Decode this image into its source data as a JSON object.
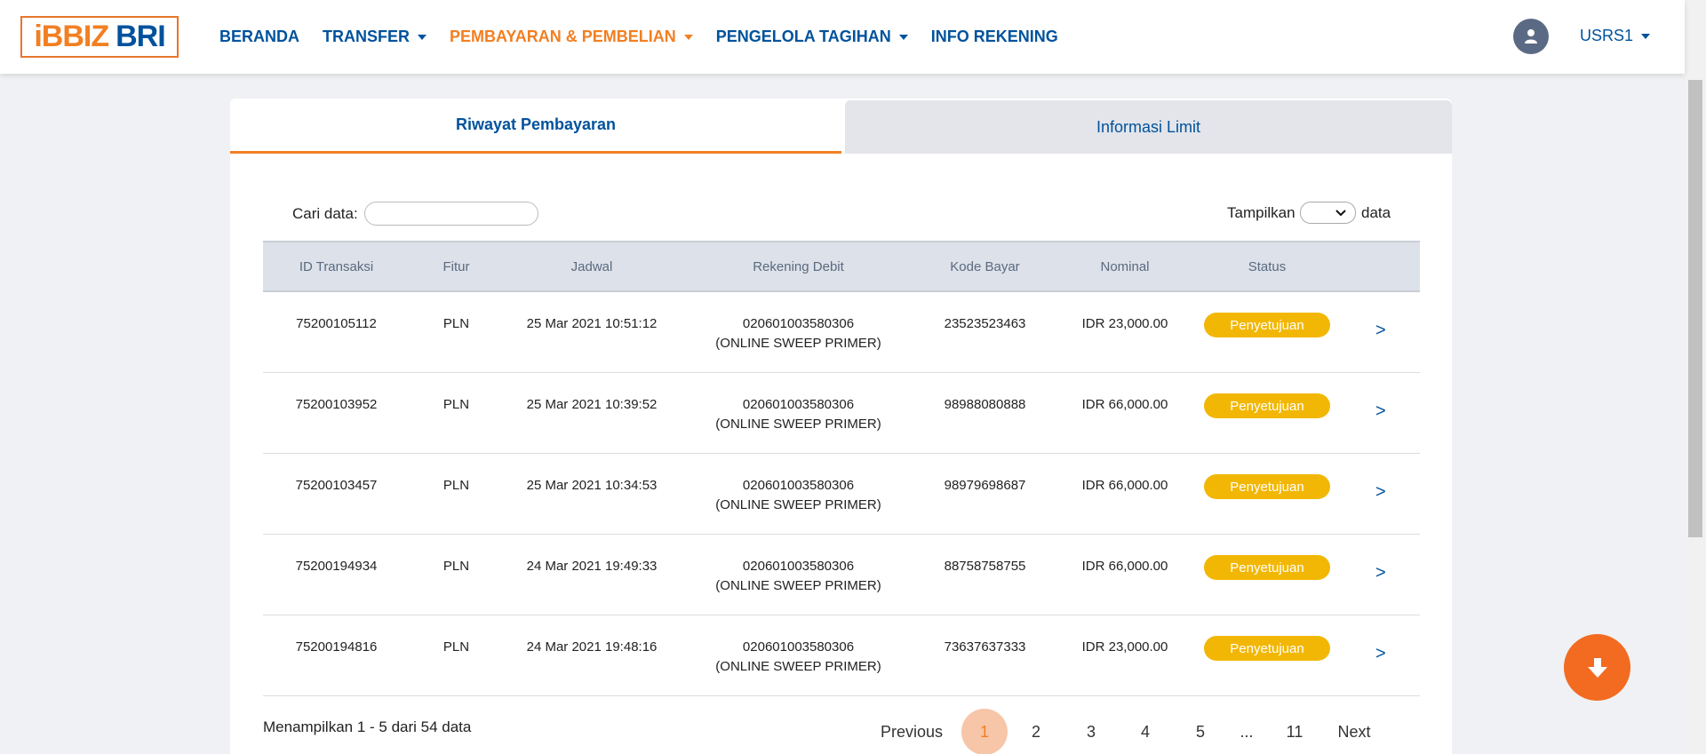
{
  "brand": {
    "part1": "iBBIZ",
    "part2": "BRI"
  },
  "nav": {
    "items": [
      {
        "label": "BERANDA",
        "dropdown": false,
        "active": false
      },
      {
        "label": "TRANSFER",
        "dropdown": true,
        "active": false
      },
      {
        "label": "PEMBAYARAN & PEMBELIAN",
        "dropdown": true,
        "active": true
      },
      {
        "label": "PENGELOLA TAGIHAN",
        "dropdown": true,
        "active": false
      },
      {
        "label": "INFO REKENING",
        "dropdown": false,
        "active": false
      }
    ],
    "user": "USRS1"
  },
  "tabs": [
    {
      "label": "Riwayat Pembayaran",
      "active": true
    },
    {
      "label": "Informasi Limit",
      "active": false
    }
  ],
  "search": {
    "label": "Cari data:",
    "value": ""
  },
  "page_size": {
    "prefix": "Tampilkan",
    "suffix": "data",
    "value": ""
  },
  "table": {
    "headers": [
      "ID Transaksi",
      "Fitur",
      "Jadwal",
      "Rekening Debit",
      "Kode Bayar",
      "Nominal",
      "Status"
    ],
    "rows": [
      {
        "id": "75200105112",
        "fitur": "PLN",
        "jadwal": "25 Mar 2021 10:51:12",
        "rekening": "020601003580306",
        "rekening_name": "(ONLINE SWEEP PRIMER)",
        "kode": "23523523463",
        "nominal": "IDR 23,000.00",
        "status": "Penyetujuan"
      },
      {
        "id": "75200103952",
        "fitur": "PLN",
        "jadwal": "25 Mar 2021 10:39:52",
        "rekening": "020601003580306",
        "rekening_name": "(ONLINE SWEEP PRIMER)",
        "kode": "98988080888",
        "nominal": "IDR 66,000.00",
        "status": "Penyetujuan"
      },
      {
        "id": "75200103457",
        "fitur": "PLN",
        "jadwal": "25 Mar 2021 10:34:53",
        "rekening": "020601003580306",
        "rekening_name": "(ONLINE SWEEP PRIMER)",
        "kode": "98979698687",
        "nominal": "IDR 66,000.00",
        "status": "Penyetujuan"
      },
      {
        "id": "75200194934",
        "fitur": "PLN",
        "jadwal": "24 Mar 2021 19:49:33",
        "rekening": "020601003580306",
        "rekening_name": "(ONLINE SWEEP PRIMER)",
        "kode": "88758758755",
        "nominal": "IDR 66,000.00",
        "status": "Penyetujuan"
      },
      {
        "id": "75200194816",
        "fitur": "PLN",
        "jadwal": "24 Mar 2021 19:48:16",
        "rekening": "020601003580306",
        "rekening_name": "(ONLINE SWEEP PRIMER)",
        "kode": "73637637333",
        "nominal": "IDR 23,000.00",
        "status": "Penyetujuan"
      }
    ],
    "row_action": ">"
  },
  "footer": {
    "info": "Menampilkan 1 - 5 dari 54 data"
  },
  "pagination": {
    "previous": "Previous",
    "pages": [
      "1",
      "2",
      "3",
      "4",
      "5",
      "...",
      "11"
    ],
    "current": "1",
    "next": "Next"
  },
  "colors": {
    "brand_blue": "#00529c",
    "brand_orange": "#f27f22",
    "badge": "#f2b705",
    "fab": "#f26b21"
  }
}
